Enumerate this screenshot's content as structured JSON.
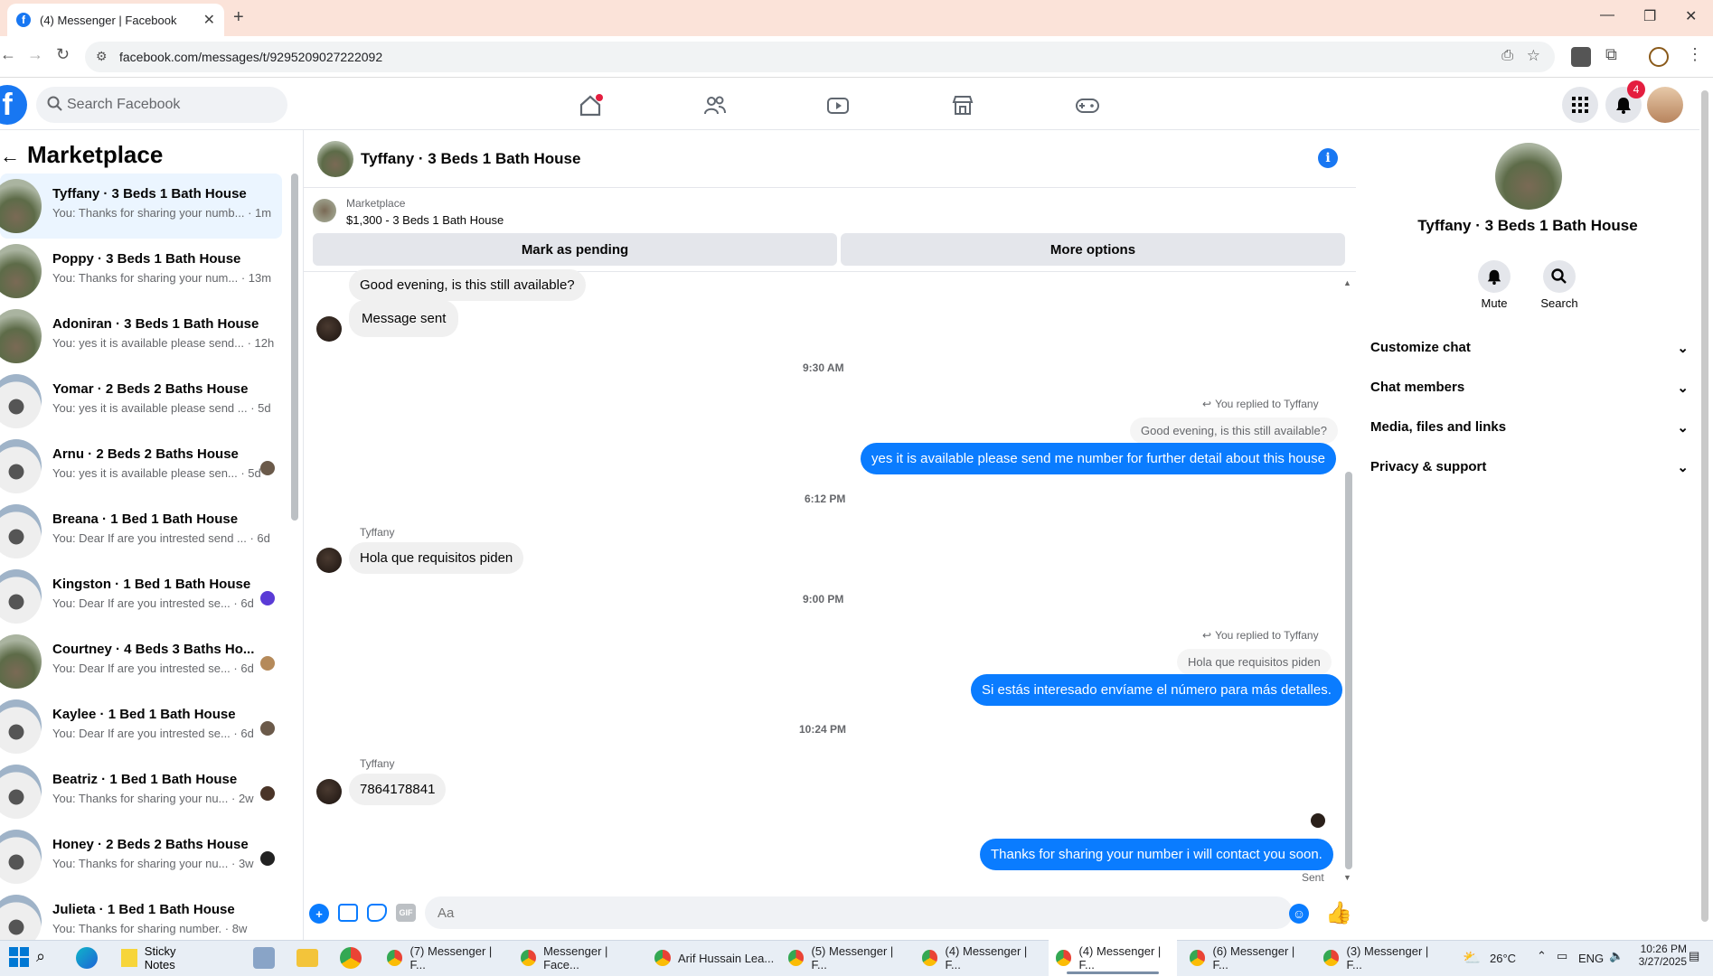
{
  "browser": {
    "tab_title": "(4) Messenger | Facebook",
    "url": "facebook.com/messages/t/9295209027222092"
  },
  "fb": {
    "search_placeholder": "Search Facebook",
    "notif_count": "4"
  },
  "sidebar": {
    "title": "Marketplace",
    "conversations": [
      {
        "name": "Tyffany · 3 Beds 1 Bath House",
        "preview": "You: Thanks for sharing your numb... · 1m"
      },
      {
        "name": "Poppy · 3 Beds 1 Bath House",
        "preview": "You: Thanks for sharing your num... · 13m"
      },
      {
        "name": "Adoniran · 3 Beds 1 Bath House",
        "preview": "You: yes it is available please send... · 12h"
      },
      {
        "name": "Yomar · 2 Beds 2 Baths House",
        "preview": "You: yes it is available please send ... · 5d"
      },
      {
        "name": "Arnu · 2 Beds 2 Baths House",
        "preview": "You: yes it is available please sen... · 5d"
      },
      {
        "name": "Breana · 1 Bed 1 Bath House",
        "preview": "You: Dear If are you intrested send ... · 6d"
      },
      {
        "name": "Kingston · 1 Bed 1 Bath House",
        "preview": "You: Dear If are you intrested se... · 6d"
      },
      {
        "name": "Courtney · 4 Beds 3 Baths Ho...",
        "preview": "You: Dear If are you intrested se... · 6d"
      },
      {
        "name": "Kaylee · 1 Bed 1 Bath House",
        "preview": "You: Dear If are you intrested se... · 6d"
      },
      {
        "name": "Beatriz · 1 Bed 1 Bath House",
        "preview": "You: Thanks for sharing your nu... · 2w"
      },
      {
        "name": "Honey · 2 Beds 2 Baths House",
        "preview": "You: Thanks for sharing your nu... · 3w"
      },
      {
        "name": "Julieta · 1 Bed 1 Bath House",
        "preview": "You: Thanks for sharing number. · 8w"
      }
    ]
  },
  "chat": {
    "title": "Tyffany · 3 Beds 1 Bath House",
    "marketplace_label": "Marketplace",
    "listing": "$1,300 - 3 Beds 1 Bath House",
    "btn_pending": "Mark as pending",
    "btn_more": "More options",
    "msg1": "Good evening, is this still available?",
    "msg2": "Message sent",
    "ts1": "9:30 AM",
    "reply_label1": "You replied to Tyffany",
    "quoted1": "Good evening, is this still available?",
    "msg3": "yes it is available please send me number for further detail about this house",
    "ts2": "6:12 PM",
    "sender": "Tyffany",
    "msg4": "Hola que requisitos piden",
    "ts3": "9:00 PM",
    "reply_label2": "You replied to Tyffany",
    "quoted2": "Hola que requisitos piden",
    "msg5": "Si estás interesado envíame el número para más detalles.",
    "ts4": "10:24 PM",
    "msg6": "7864178841",
    "msg7": "Thanks for sharing your number i will contact you soon.",
    "sent": "Sent",
    "input_placeholder": "Aa"
  },
  "right": {
    "title": "Tyffany · 3 Beds 1 Bath House",
    "mute": "Mute",
    "search": "Search",
    "rows": [
      "Customize chat",
      "Chat members",
      "Media, files and links",
      "Privacy & support"
    ]
  },
  "taskbar": {
    "sticky": "Sticky Notes",
    "tasks": [
      "(7) Messenger | F...",
      "Messenger | Face...",
      "Arif Hussain Lea...",
      "(5) Messenger | F...",
      "(4) Messenger | F...",
      "(4) Messenger | F...",
      "(6) Messenger | F...",
      "(3) Messenger | F..."
    ],
    "temp": "26°C",
    "lang": "ENG",
    "time": "10:26 PM",
    "date": "3/27/2025"
  },
  "colors": {
    "accent": "#0a7cff",
    "brand": "#1877f2"
  }
}
